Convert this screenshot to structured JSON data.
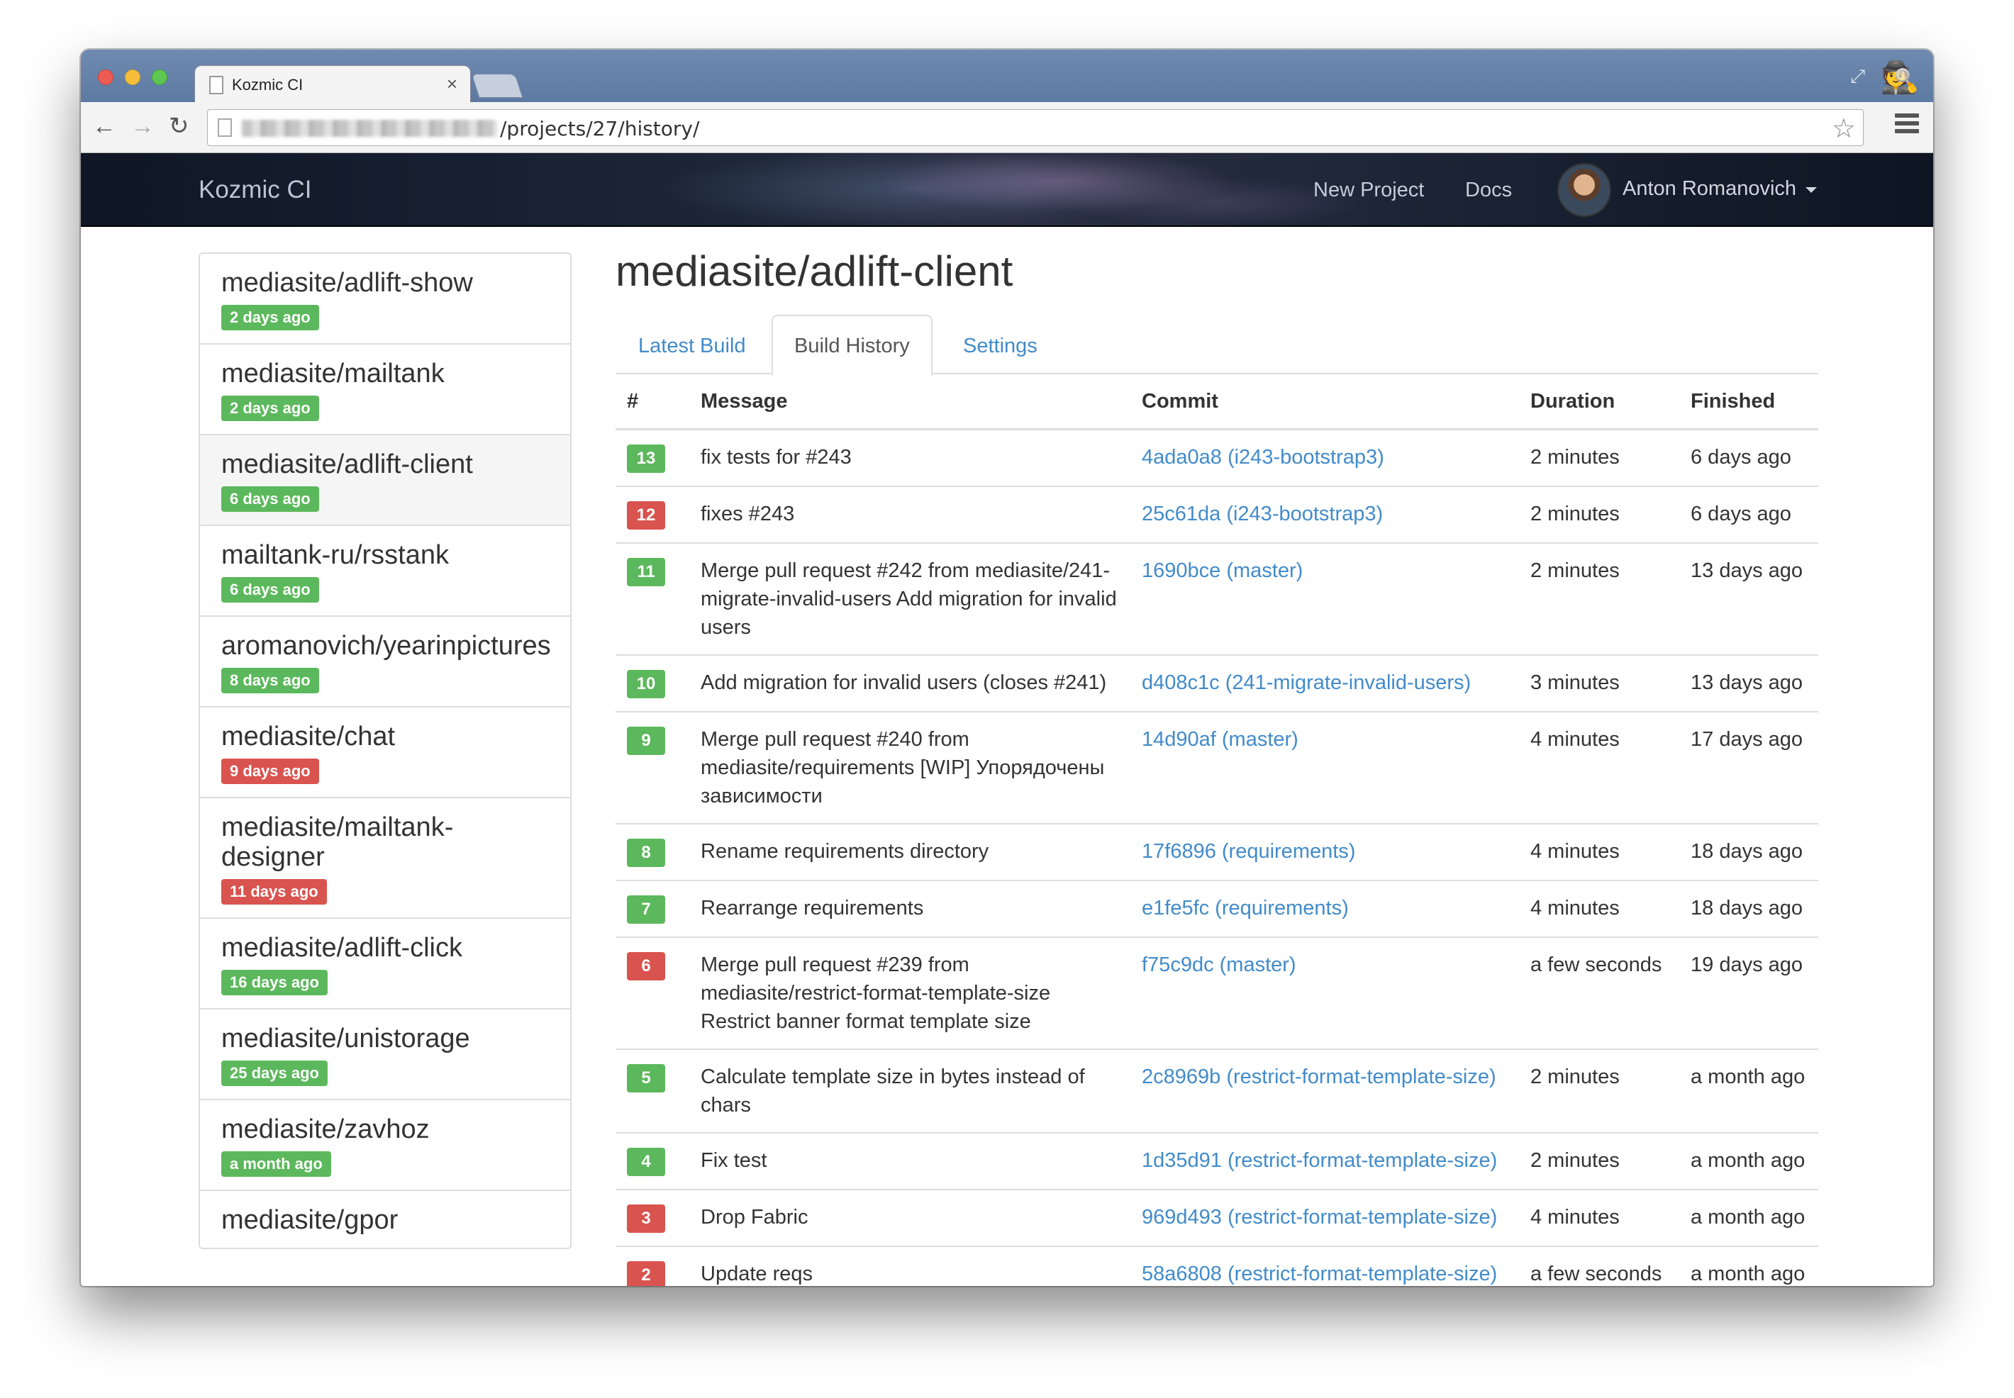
{
  "browser": {
    "tab_title": "Kozmic CI",
    "url_path": "/projects/27/history/"
  },
  "navbar": {
    "brand": "Kozmic CI",
    "new_project": "New Project",
    "docs": "Docs",
    "user": "Anton Romanovich"
  },
  "sidebar": {
    "items": [
      {
        "name": "mediasite/adlift-show",
        "badge": "2 days ago",
        "status": "ok"
      },
      {
        "name": "mediasite/mailtank",
        "badge": "2 days ago",
        "status": "ok"
      },
      {
        "name": "mediasite/adlift-client",
        "badge": "6 days ago",
        "status": "ok"
      },
      {
        "name": "mailtank-ru/rsstank",
        "badge": "6 days ago",
        "status": "ok"
      },
      {
        "name": "aromanovich/yearinpictures",
        "badge": "8 days ago",
        "status": "ok"
      },
      {
        "name": "mediasite/chat",
        "badge": "9 days ago",
        "status": "fail"
      },
      {
        "name": "mediasite/mailtank-designer",
        "badge": "11 days ago",
        "status": "fail"
      },
      {
        "name": "mediasite/adlift-click",
        "badge": "16 days ago",
        "status": "ok"
      },
      {
        "name": "mediasite/unistorage",
        "badge": "25 days ago",
        "status": "ok"
      },
      {
        "name": "mediasite/zavhoz",
        "badge": "a month ago",
        "status": "ok"
      },
      {
        "name": "mediasite/gpor",
        "badge": "",
        "status": "none"
      }
    ]
  },
  "main": {
    "title": "mediasite/adlift-client",
    "tabs": [
      "Latest Build",
      "Build History",
      "Settings"
    ],
    "columns": [
      "#",
      "Message",
      "Commit",
      "Duration",
      "Finished"
    ],
    "rows": [
      {
        "num": "13",
        "status": "ok",
        "message": "fix tests for #243",
        "commit": "4ada0a8 (i243-bootstrap3)",
        "duration": "2 minutes",
        "finished": "6 days ago"
      },
      {
        "num": "12",
        "status": "fail",
        "message": "fixes #243",
        "commit": "25c61da (i243-bootstrap3)",
        "duration": "2 minutes",
        "finished": "6 days ago"
      },
      {
        "num": "11",
        "status": "ok",
        "message": "Merge pull request #242 from mediasite/241-migrate-invalid-users Add migration for invalid users",
        "commit": "1690bce (master)",
        "duration": "2 minutes",
        "finished": "13 days ago"
      },
      {
        "num": "10",
        "status": "ok",
        "message": "Add migration for invalid users (closes #241)",
        "commit": "d408c1c (241-migrate-invalid-users)",
        "duration": "3 minutes",
        "finished": "13 days ago"
      },
      {
        "num": "9",
        "status": "ok",
        "message": "Merge pull request #240 from mediasite/requirements [WIP] Упорядочены зависимости",
        "commit": "14d90af (master)",
        "duration": "4 minutes",
        "finished": "17 days ago"
      },
      {
        "num": "8",
        "status": "ok",
        "message": "Rename requirements directory",
        "commit": "17f6896 (requirements)",
        "duration": "4 minutes",
        "finished": "18 days ago"
      },
      {
        "num": "7",
        "status": "ok",
        "message": "Rearrange requirements",
        "commit": "e1fe5fc (requirements)",
        "duration": "4 minutes",
        "finished": "18 days ago"
      },
      {
        "num": "6",
        "status": "fail",
        "message": "Merge pull request #239 from mediasite/restrict-format-template-size Restrict banner format template size",
        "commit": "f75c9dc (master)",
        "duration": "a few seconds",
        "finished": "19 days ago"
      },
      {
        "num": "5",
        "status": "ok",
        "message": "Calculate template size in bytes instead of chars",
        "commit": "2c8969b (restrict-format-template-size)",
        "duration": "2 minutes",
        "finished": "a month ago"
      },
      {
        "num": "4",
        "status": "ok",
        "message": "Fix test",
        "commit": "1d35d91 (restrict-format-template-size)",
        "duration": "2 minutes",
        "finished": "a month ago"
      },
      {
        "num": "3",
        "status": "fail",
        "message": "Drop Fabric",
        "commit": "969d493 (restrict-format-template-size)",
        "duration": "4 minutes",
        "finished": "a month ago"
      },
      {
        "num": "2",
        "status": "fail",
        "message": "Update reqs",
        "commit": "58a6808 (restrict-format-template-size)",
        "duration": "a few seconds",
        "finished": "a month ago"
      }
    ]
  },
  "colors": {
    "success": "#5cb85c",
    "danger": "#d9534f",
    "link": "#428bca"
  },
  "icons": [
    "doc-icon",
    "close-icon",
    "back-icon",
    "forward-icon",
    "reload-icon",
    "star-icon",
    "menu-icon",
    "incognito-icon",
    "fullscreen-icon",
    "caret-down-icon"
  ]
}
